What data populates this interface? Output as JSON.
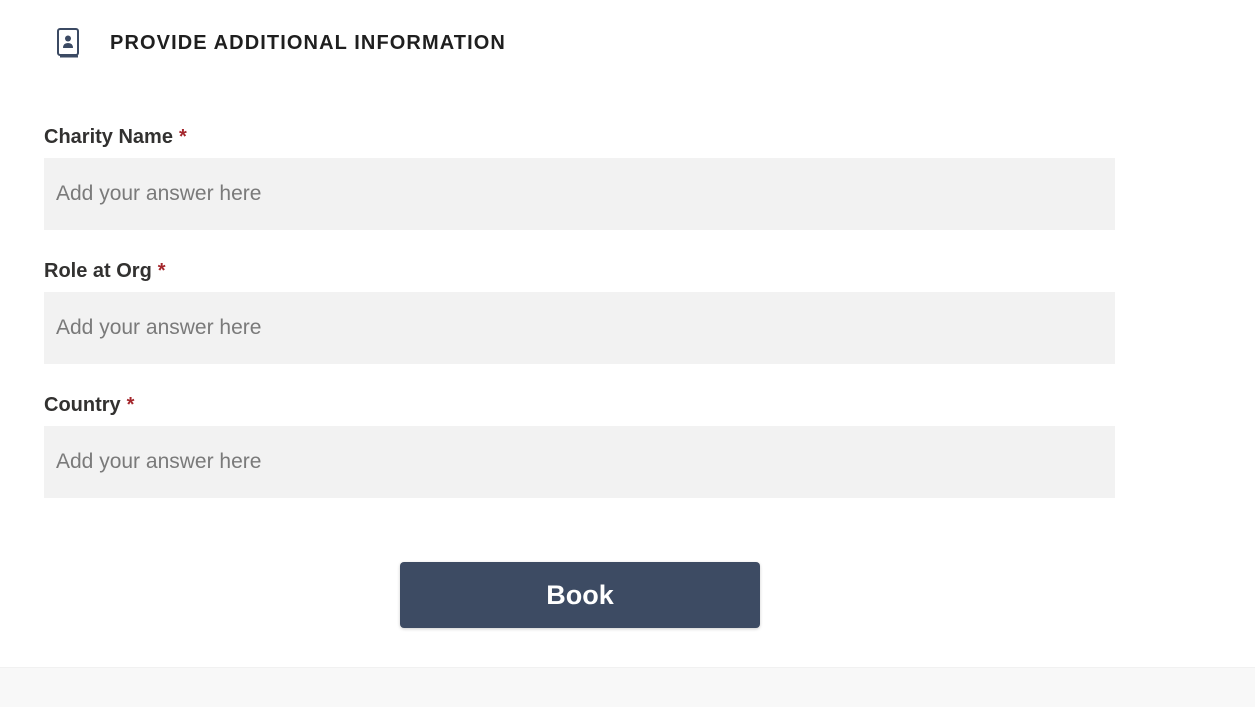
{
  "section": {
    "title": "PROVIDE ADDITIONAL INFORMATION",
    "icon": "contact-book-icon"
  },
  "fields": [
    {
      "label": "Charity Name",
      "required_mark": "*",
      "value": "",
      "placeholder": "Add your answer here"
    },
    {
      "label": "Role at Org",
      "required_mark": "*",
      "value": "",
      "placeholder": "Add your answer here"
    },
    {
      "label": "Country",
      "required_mark": "*",
      "value": "",
      "placeholder": "Add your answer here"
    }
  ],
  "actions": {
    "book_label": "Book"
  },
  "colors": {
    "button_background": "#3d4b63",
    "required_star": "#a4262c",
    "input_background": "#f2f2f2"
  }
}
